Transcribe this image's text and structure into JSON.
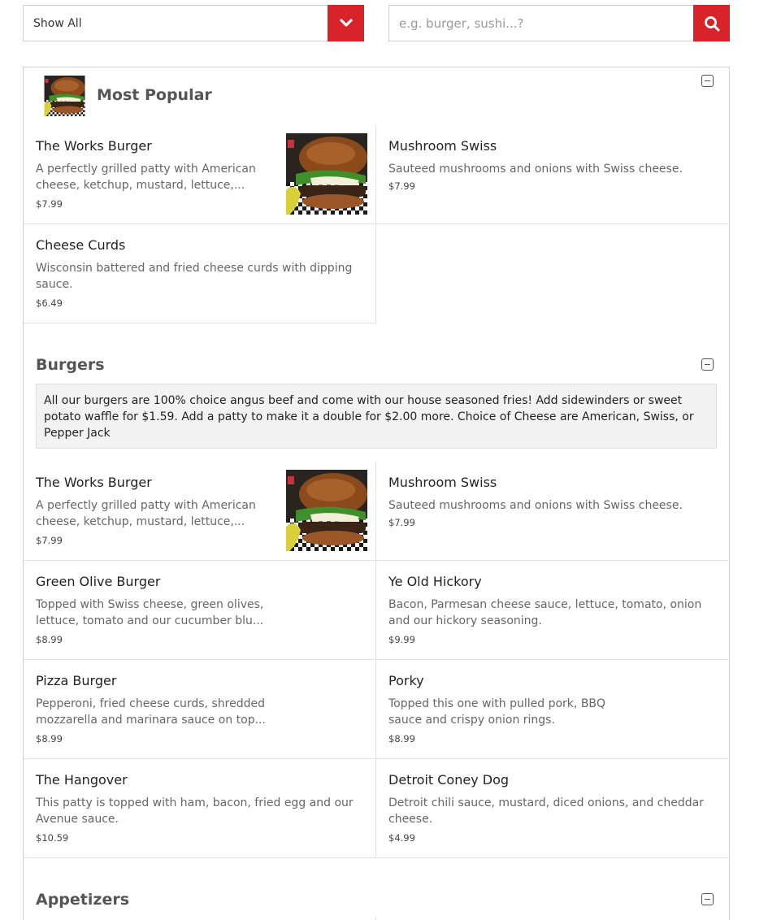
{
  "filter": {
    "selected": "Show All"
  },
  "search": {
    "placeholder": "e.g. burger, sushi...?"
  },
  "sections": {
    "popular": {
      "title": "Most Popular",
      "items": [
        {
          "name": "The Works Burger",
          "desc": "A perfectly grilled patty with American cheese, ketchup, mustard, lettuce,...",
          "price": "$7.99"
        },
        {
          "name": "Mushroom Swiss",
          "desc": "Sauteed mushrooms and onions with Swiss cheese.",
          "price": "$7.99"
        },
        {
          "name": "Cheese Curds",
          "desc": "Wisconsin battered and fried cheese curds with dipping sauce.",
          "price": "$6.49"
        }
      ]
    },
    "burgers": {
      "title": "Burgers",
      "notice": "All our burgers are 100% choice angus beef and come with our house seasoned fries! Add sidewinders or sweet potato waffle for $1.59. Add a patty to make it a double for $2.00 more. Choice of Cheese are American, Swiss, or Pepper Jack",
      "items": [
        {
          "name": "The Works Burger",
          "desc": "A perfectly grilled patty with American cheese, ketchup, mustard, lettuce,...",
          "price": "$7.99"
        },
        {
          "name": "Mushroom Swiss",
          "desc": "Sauteed mushrooms and onions with Swiss cheese.",
          "price": "$7.99"
        },
        {
          "name": "Green Olive Burger",
          "desc": "Topped with Swiss cheese, green olives, lettuce, tomato and our cucumber blu...",
          "price": "$8.99"
        },
        {
          "name": "Ye Old Hickory",
          "desc": "Bacon, Parmesan cheese sauce, lettuce, tomato, onion and our hickory seasoning.",
          "price": "$9.99"
        },
        {
          "name": "Pizza Burger",
          "desc": "Pepperoni, fried cheese curds, shredded mozzarella and marinara sauce on top...",
          "price": "$8.99"
        },
        {
          "name": "Porky",
          "desc": "Topped this one with pulled pork, BBQ sauce and crispy onion rings.",
          "price": "$8.99"
        },
        {
          "name": "The Hangover",
          "desc": "This patty is topped with ham, bacon, fried egg and our Avenue sauce.",
          "price": "$10.59"
        },
        {
          "name": "Detroit Coney Dog",
          "desc": "Detroit chili sauce, mustard, diced onions, and cheddar cheese.",
          "price": "$4.99"
        }
      ]
    },
    "appetizers": {
      "title": "Appetizers"
    }
  },
  "icons": {
    "dropdown": "chevron-down-icon",
    "search": "search-icon",
    "collapse": "collapse-minus-icon"
  },
  "colors": {
    "accent": "#d8232a"
  }
}
